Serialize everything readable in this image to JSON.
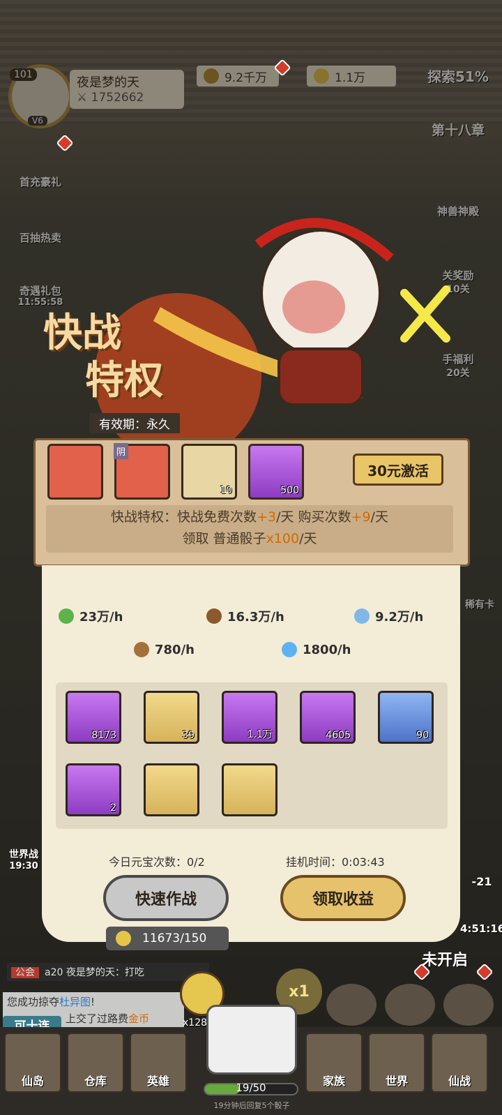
{
  "player": {
    "level": "101",
    "vip": "V6",
    "name": "夜是梦的天",
    "power": "1752662"
  },
  "resources": {
    "coins": "9.2千万",
    "ingots": "1.1万"
  },
  "explore": {
    "label": "探索51%",
    "chapter": "第十八章"
  },
  "left_menu": [
    "首充豪礼",
    "百抽热卖",
    "奇遇礼包"
  ],
  "left_menu_timer": "11:55:58",
  "right_menu": [
    "神兽神殿",
    "关奖励",
    "10关",
    "手福利",
    "20关",
    "稀有卡"
  ],
  "privilege": {
    "title_line1": "快战",
    "title_line2": "特权",
    "validity": "有效期：永久",
    "activate_button": "30元激活",
    "rewards": [
      {
        "count": ""
      },
      {
        "badge": "阴",
        "count": ""
      },
      {
        "count": "10"
      },
      {
        "count": "500"
      }
    ],
    "desc_prefix": "快战特权：快战免费次数",
    "desc_free": "+3",
    "desc_mid": "/天 购买次数",
    "desc_buy": "+9",
    "desc_suffix": "/天",
    "desc2_prefix": "领取 普通骰子",
    "desc2_val": "x100",
    "desc2_suffix": "/天"
  },
  "rates": [
    {
      "icon": "exp-icon",
      "value": "23万/h"
    },
    {
      "icon": "coin-icon",
      "value": "16.3万/h"
    },
    {
      "icon": "potion-icon",
      "value": "9.2万/h"
    },
    {
      "icon": "spiral-icon",
      "value": "780/h"
    },
    {
      "icon": "flame-icon",
      "value": "1800/h"
    }
  ],
  "items": [
    {
      "icon": "coin-icon",
      "count": "8173",
      "color": "purple"
    },
    {
      "icon": "spiral-icon",
      "count": "39",
      "color": "gold"
    },
    {
      "icon": "exp-icon",
      "count": "1.1万",
      "color": "purple"
    },
    {
      "icon": "potion-icon",
      "count": "4605",
      "color": "purple"
    },
    {
      "icon": "flame-icon",
      "count": "90",
      "color": "blue"
    },
    {
      "icon": "crystal-icon",
      "count": "2",
      "color": "purple"
    },
    {
      "icon": "ingot-icon",
      "count": "",
      "color": "gold"
    },
    {
      "icon": "bun-icon",
      "count": "",
      "color": "gold"
    }
  ],
  "ingot_times": "今日元宝次数：0/2",
  "idle_time": "挂机时间：0:03:43",
  "quick_battle_button": "快速作战",
  "claim_button": "领取收益",
  "ingot_cost": "11673/150",
  "world_battle": "世界战",
  "world_time": "19:30",
  "event_range": "-21",
  "event_timer": "4:51:16",
  "event_status": "未开启",
  "chat": {
    "channel": "公会",
    "message": "a20 夜是梦的天：打吃",
    "msg2_prefix": "您成功掠夺",
    "msg2_name": "杜异图",
    "msg2_suffix": "!",
    "msg3_prefix": "上交了过路费",
    "msg3_item": "金币"
  },
  "ten_draw": "可十连",
  "dice_count": "x128",
  "multiplier": "x1",
  "energy": {
    "value": "19/50",
    "note": "19分钟后回复5个骰子"
  },
  "nav": [
    "仙岛",
    "仓库",
    "英雄",
    "家族",
    "世界",
    "仙战"
  ]
}
